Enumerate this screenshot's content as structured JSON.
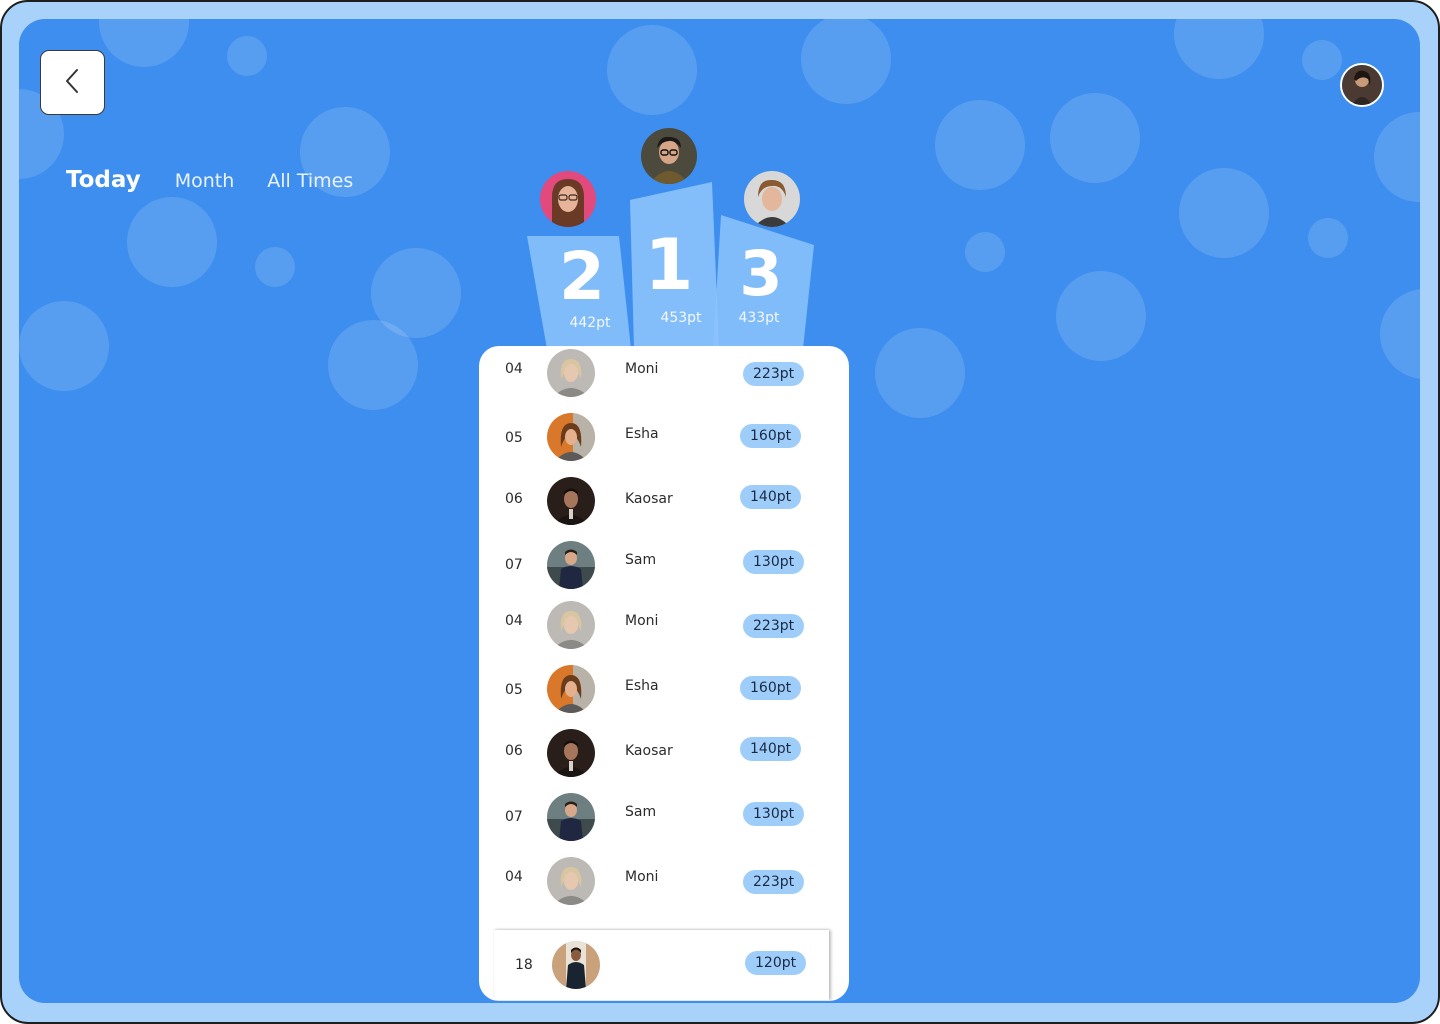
{
  "header": {
    "back_icon": "chevron-left-icon",
    "profile_avatar": "profile-avatar"
  },
  "tabs": [
    {
      "label": "Today",
      "active": true
    },
    {
      "label": "Month",
      "active": false
    },
    {
      "label": "All Times",
      "active": false
    }
  ],
  "podium": [
    {
      "rank": "2",
      "points": "442pt"
    },
    {
      "rank": "1",
      "points": "453pt"
    },
    {
      "rank": "3",
      "points": "433pt"
    }
  ],
  "leaderboard": [
    {
      "rank": "04",
      "name": "Moni",
      "points": "223pt"
    },
    {
      "rank": "05",
      "name": "Esha",
      "points": "160pt"
    },
    {
      "rank": "06",
      "name": "Kaosar",
      "points": "140pt"
    },
    {
      "rank": "07",
      "name": "Sam",
      "points": "130pt"
    },
    {
      "rank": "04",
      "name": "Moni",
      "points": "223pt"
    },
    {
      "rank": "05",
      "name": "Esha",
      "points": "160pt"
    },
    {
      "rank": "06",
      "name": "Kaosar",
      "points": "140pt"
    },
    {
      "rank": "07",
      "name": "Sam",
      "points": "130pt"
    },
    {
      "rank": "04",
      "name": "Moni",
      "points": "223pt"
    }
  ],
  "current_user": {
    "rank": "18",
    "points": "120pt"
  },
  "colors": {
    "background": "#3d8eee",
    "frame": "#a9d2fb",
    "badge": "#9fcdfa",
    "podium": "#8cc3fb"
  }
}
